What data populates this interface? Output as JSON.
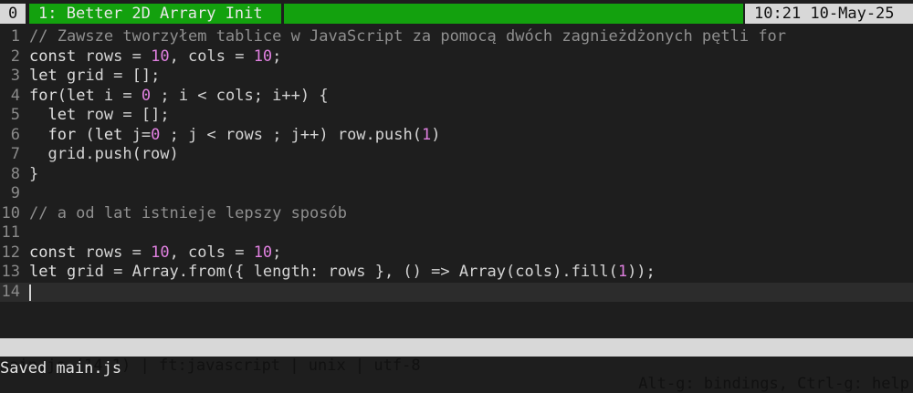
{
  "tabbar": {
    "index": "0",
    "title": "1: Better 2D Arrary Init",
    "clock": "10:21 10-May-25"
  },
  "editor": {
    "current_line": 14,
    "lines": [
      {
        "n": "1",
        "t": "// Zawsze tworzyłem tablice w JavaScript za pomocą dwóch zagnieżdżonych pętli for"
      },
      {
        "n": "2",
        "t": "const rows = 10, cols = 10;"
      },
      {
        "n": "3",
        "t": "let grid = [];"
      },
      {
        "n": "4",
        "t": "for(let i = 0 ; i < cols; i++) {"
      },
      {
        "n": "5",
        "t": "  let row = [];"
      },
      {
        "n": "6",
        "t": "  for (let j=0 ; j < rows ; j++) row.push(1)"
      },
      {
        "n": "7",
        "t": "  grid.push(row)"
      },
      {
        "n": "8",
        "t": "}"
      },
      {
        "n": "9",
        "t": ""
      },
      {
        "n": "10",
        "t": "// a od lat istnieje lepszy sposób"
      },
      {
        "n": "11",
        "t": ""
      },
      {
        "n": "12",
        "t": "const rows = 10, cols = 10;"
      },
      {
        "n": "13",
        "t": "let grid = Array.from({ length: rows }, () => Array(cols).fill(1));"
      },
      {
        "n": "14",
        "t": ""
      }
    ]
  },
  "statusbar": {
    "left": "main.js (14,1) | ft:javascript | unix | utf-8",
    "right": "Alt-g: bindings, Ctrl-g: help"
  },
  "message": "Saved main.js",
  "colors": {
    "tab_active": "#13a10e",
    "number": "#e080e0",
    "comment": "#8f8f8f",
    "line_number": "#8a8a8a"
  }
}
